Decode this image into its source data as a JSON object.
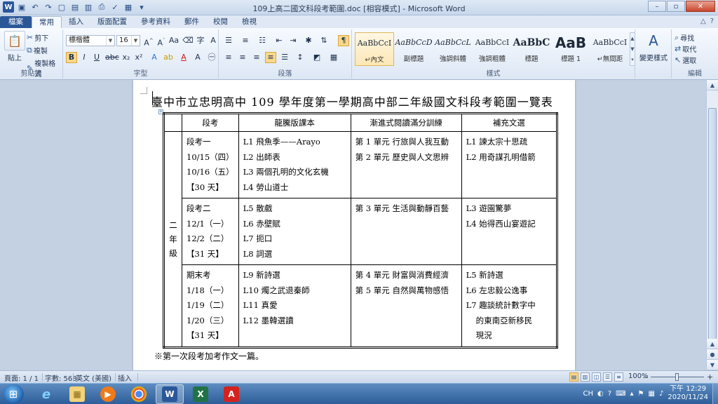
{
  "window": {
    "title": "109上高二國文科段考範圍.doc [相容模式] - Microsoft Word",
    "controls": [
      "–",
      "▫",
      "✕"
    ]
  },
  "ribbon_tabs": [
    "檔案",
    "常用",
    "插入",
    "版面配置",
    "參考資料",
    "郵件",
    "校閱",
    "檢視"
  ],
  "ribbon": {
    "clipboard": {
      "paste": "貼上",
      "cut": "剪下",
      "copy": "複製",
      "format_painter": "複製格式",
      "label": "剪貼簿"
    },
    "font": {
      "font_name": "標楷體",
      "font_size": "16",
      "label": "字型"
    },
    "paragraph": {
      "label": "段落"
    },
    "styles": {
      "label": "樣式",
      "items": [
        {
          "sample": "AaBbCcI",
          "name": "↵內文"
        },
        {
          "sample": "AaBbCcD",
          "name": "副標題"
        },
        {
          "sample": "AaBbCcL",
          "name": "強調斜體"
        },
        {
          "sample": "AaBbCcI",
          "name": "強調粗體"
        },
        {
          "sample": "AaBbC",
          "name": "標題"
        },
        {
          "sample": "AaB",
          "name": "標題 1"
        },
        {
          "sample": "AaBbCcI",
          "name": "↵無間距"
        }
      ],
      "change_styles": "變更樣式"
    },
    "editing": {
      "find": "尋找",
      "replace": "取代",
      "select": "選取",
      "label": "編輯"
    }
  },
  "document": {
    "title": "臺中市立忠明高中 109 學年度第一學期高中部二年級國文科段考範圍一覽表",
    "headers": [
      "",
      "段考",
      "龍騰版課本",
      "漸進式閱讀滿分訓練",
      "補充文選"
    ],
    "grade_label": [
      "二",
      "年",
      "級"
    ],
    "rows": [
      {
        "exam": [
          "段考一",
          "10/15（四）",
          "10/16（五）",
          "【30 天】"
        ],
        "textbook": [
          "L1 飛魚季——Arayo",
          "L2 出師表",
          "L3 兩個孔明的文化玄機",
          "L4 勞山道士"
        ],
        "reading": [
          "第 1 單元 行旅與人我互動",
          "第 2 單元 歷史與人文思辨"
        ],
        "supplement": [
          "L1 諫太宗十思疏",
          "L2 用奇謀孔明借箭"
        ]
      },
      {
        "exam": [
          "段考二",
          "12/1（一）",
          "12/2（二）",
          "【31 天】"
        ],
        "textbook": [
          "L5 散戲",
          "L6 赤壁賦",
          "L7 扼口",
          "L8 詞選"
        ],
        "reading": [
          "第 3 單元 生活與動靜百藝"
        ],
        "supplement": [
          "L3 遊園驚夢",
          "L4 始得西山宴遊記"
        ]
      },
      {
        "exam": [
          "期末考",
          "1/18（一）",
          "1/19（二）",
          "1/20（三）",
          "【31 天】"
        ],
        "textbook": [
          "L9 新詩選",
          "L10 燭之武退秦師",
          "L11 真愛",
          "L12 墨韓選讀"
        ],
        "reading": [
          "第 4 單元 財富與消費經濟",
          "第 5 單元 自然與萬物感悟"
        ],
        "supplement": [
          "L5 新詩選",
          "L6 左忠毅公逸事",
          "L7 趣談統計數字中",
          "的東南亞新移民",
          "現況"
        ]
      }
    ],
    "footnote": "※第一次段考加考作文一篇。"
  },
  "status": {
    "page": "頁面: 1 / 1",
    "words": "字數: 568",
    "language": "英文 (美國)",
    "mode": "插入",
    "zoom": "100%"
  },
  "taskbar": {
    "apps": [
      "e",
      "▦",
      "▶",
      "◉",
      "W",
      "X",
      "A"
    ],
    "tray_lang": "CH",
    "time": "下午 12:29",
    "date": "2020/11/24"
  },
  "colors": {
    "file_tab": "#2b5797",
    "taskbar": "#3a6ea5",
    "highlight": "#fbd98b",
    "close": "#c7462c"
  }
}
